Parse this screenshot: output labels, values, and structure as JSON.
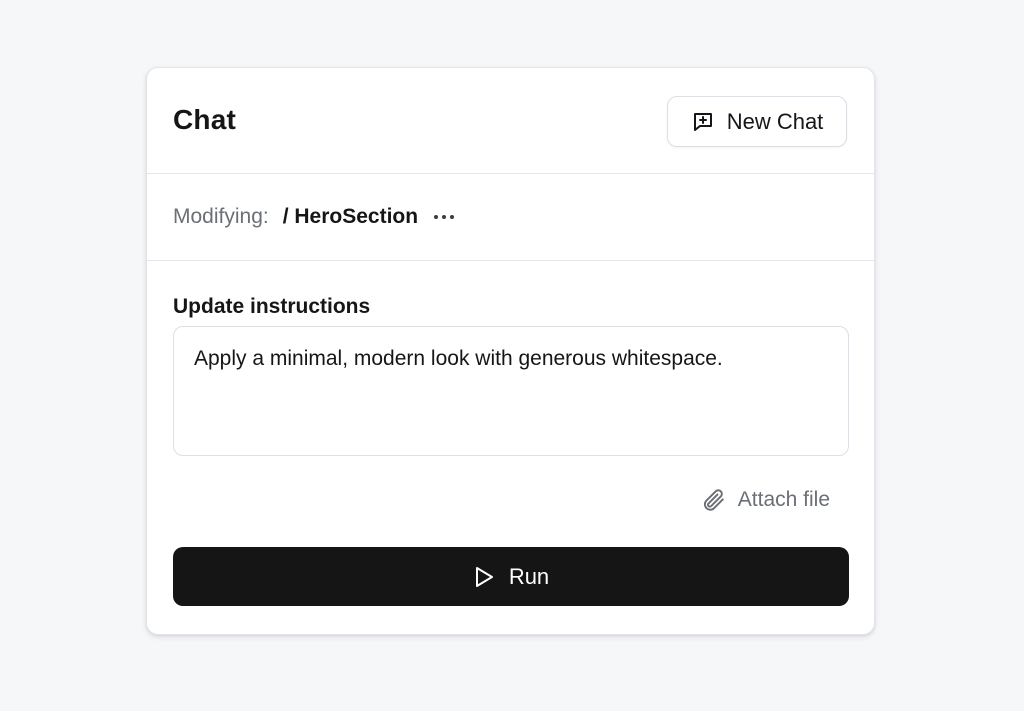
{
  "header": {
    "title": "Chat",
    "new_chat_label": "New Chat",
    "new_chat_icon": "message-plus-icon"
  },
  "context": {
    "modifying_label": "Modifying:",
    "target": "/ HeroSection",
    "more_icon": "ellipsis-icon"
  },
  "instructions": {
    "label": "Update instructions",
    "value": "Apply a minimal, modern look with generous whitespace."
  },
  "attach": {
    "label": "Attach file",
    "icon": "paperclip-icon"
  },
  "run": {
    "label": "Run",
    "icon": "play-icon"
  },
  "colors": {
    "background": "#f6f7f9",
    "panel": "#ffffff",
    "primary_button": "#151515",
    "muted_text": "#6b6f76"
  }
}
